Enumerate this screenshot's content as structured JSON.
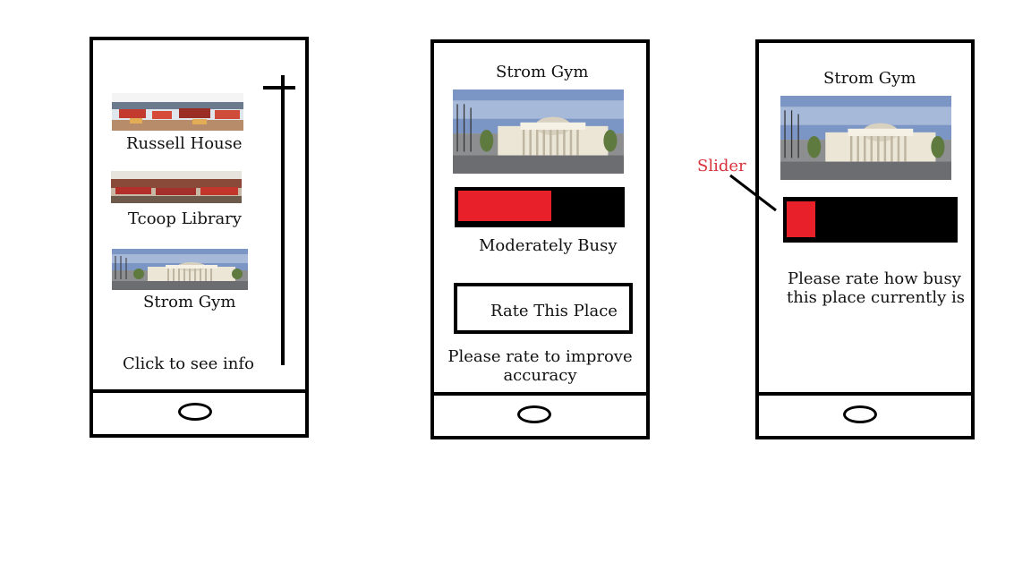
{
  "colors": {
    "outline": "#000000",
    "fill_red": "#e8202a",
    "annotation_red": "#d9323a"
  },
  "screen1": {
    "items": [
      {
        "label": "Russell House"
      },
      {
        "label": "Tcoop Library"
      },
      {
        "label": "Strom Gym"
      }
    ],
    "hint": "Click to see info"
  },
  "screen2": {
    "title": "Strom Gym",
    "busyness_fraction": 0.57,
    "status": "Moderately Busy",
    "rate_button": "Rate This Place",
    "note": "Please rate to improve accuracy"
  },
  "screen3": {
    "title": "Strom Gym",
    "slider_fraction": 0.17,
    "prompt_line1": "Please rate how busy",
    "prompt_line2": "this place currently is"
  },
  "annotation": {
    "label": "Slider"
  }
}
